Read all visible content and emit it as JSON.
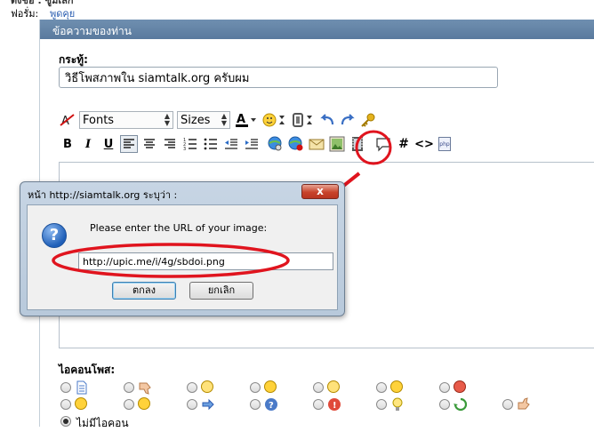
{
  "header": {
    "cut_text": "ตั้งชื่อ : ซูมเล็ก",
    "forum_label": "ฟอรั่ม:",
    "forum_link": "พูดคุย"
  },
  "panel": {
    "title": "ข้อความของท่าน"
  },
  "thread": {
    "label": "กระทู้:",
    "value": "วิธีโพสภาพใน siamtalk.org ครับผม"
  },
  "toolbar": {
    "fonts_label": "Fonts",
    "sizes_label": "Sizes",
    "bold": "B",
    "italic": "I",
    "underline": "U",
    "hash": "#",
    "code": "<>",
    "php": "php"
  },
  "icons_section": {
    "label": "ไอคอนโพส:",
    "no_icon_label": "ไม่มีไอคอน"
  },
  "dialog": {
    "title": "หน้า http://siamtalk.org ระบุว่า :",
    "close_label": "x",
    "message": "Please enter the URL of your image:",
    "input_value": "http://upic.me/i/4g/sbdoi.png",
    "ok_label": "ตกลง",
    "cancel_label": "ยกเลิก"
  },
  "colors": {
    "panel_header": "#5a7a9e",
    "annotation": "#e0141e",
    "link": "#2a5db0"
  }
}
